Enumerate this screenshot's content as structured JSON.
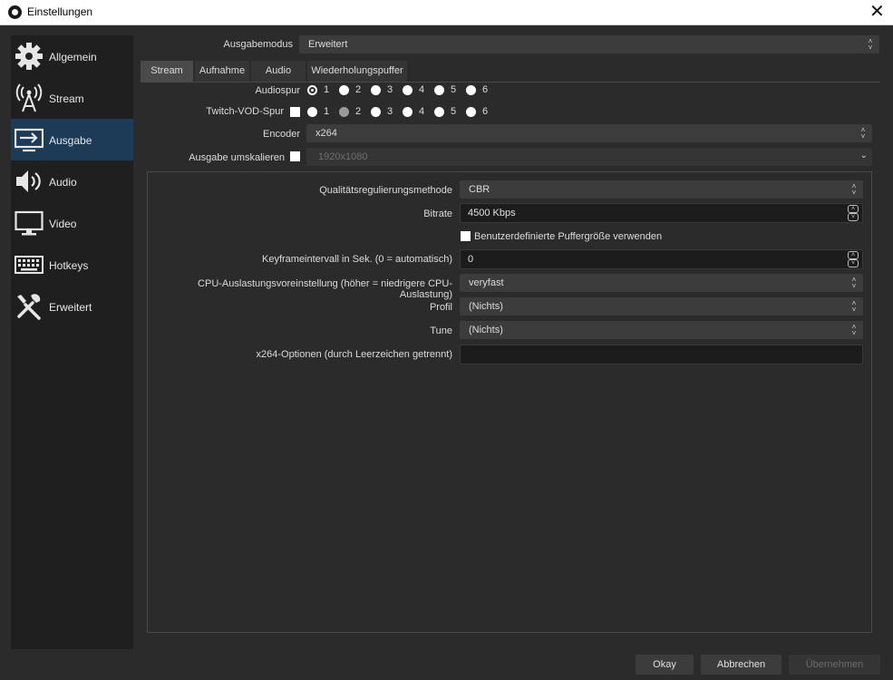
{
  "window": {
    "title": "Einstellungen",
    "close_glyph": "✕"
  },
  "sidebar": {
    "items": [
      {
        "label": "Allgemein",
        "icon": "gear-icon"
      },
      {
        "label": "Stream",
        "icon": "antenna-icon"
      },
      {
        "label": "Ausgabe",
        "icon": "output-icon",
        "active": true
      },
      {
        "label": "Audio",
        "icon": "speaker-icon"
      },
      {
        "label": "Video",
        "icon": "monitor-icon"
      },
      {
        "label": "Hotkeys",
        "icon": "keyboard-icon"
      },
      {
        "label": "Erweitert",
        "icon": "tools-icon"
      }
    ]
  },
  "output": {
    "mode_label": "Ausgabemodus",
    "mode_value": "Erweitert",
    "tabs": [
      "Stream",
      "Aufnahme",
      "Audio",
      "Wiederholungspuffer"
    ],
    "active_tab": "Stream",
    "audio_track_label": "Audiospur",
    "audio_track_options": [
      "1",
      "2",
      "3",
      "4",
      "5",
      "6"
    ],
    "audio_track_selected": "1",
    "twitch_vod_label": "Twitch-VOD-Spur",
    "twitch_vod_options": [
      "1",
      "2",
      "3",
      "4",
      "5",
      "6"
    ],
    "encoder_label": "Encoder",
    "encoder_value": "x264",
    "rescale_label": "Ausgabe umskalieren",
    "rescale_value": "1920x1080",
    "rate_control_label": "Qualitätsregulierungsmethode",
    "rate_control_value": "CBR",
    "bitrate_label": "Bitrate",
    "bitrate_value": "4500 Kbps",
    "custom_buffer_label": "Benutzerdefinierte Puffergröße verwenden",
    "keyframe_label": "Keyframeintervall in Sek. (0 = automatisch)",
    "keyframe_value": "0",
    "cpu_preset_label": "CPU-Auslastungsvoreinstellung (höher = niedrigere CPU-Auslastung)",
    "cpu_preset_value": "veryfast",
    "profile_label": "Profil",
    "profile_value": "(Nichts)",
    "tune_label": "Tune",
    "tune_value": "(Nichts)",
    "x264_options_label": "x264-Optionen (durch Leerzeichen getrennt)",
    "x264_options_value": ""
  },
  "buttons": {
    "ok": "Okay",
    "cancel": "Abbrechen",
    "apply": "Übernehmen"
  },
  "colors": {
    "active_sidebar": "#1d3a57",
    "background": "#2b2b2b",
    "sidebar": "#1f1f1f"
  }
}
